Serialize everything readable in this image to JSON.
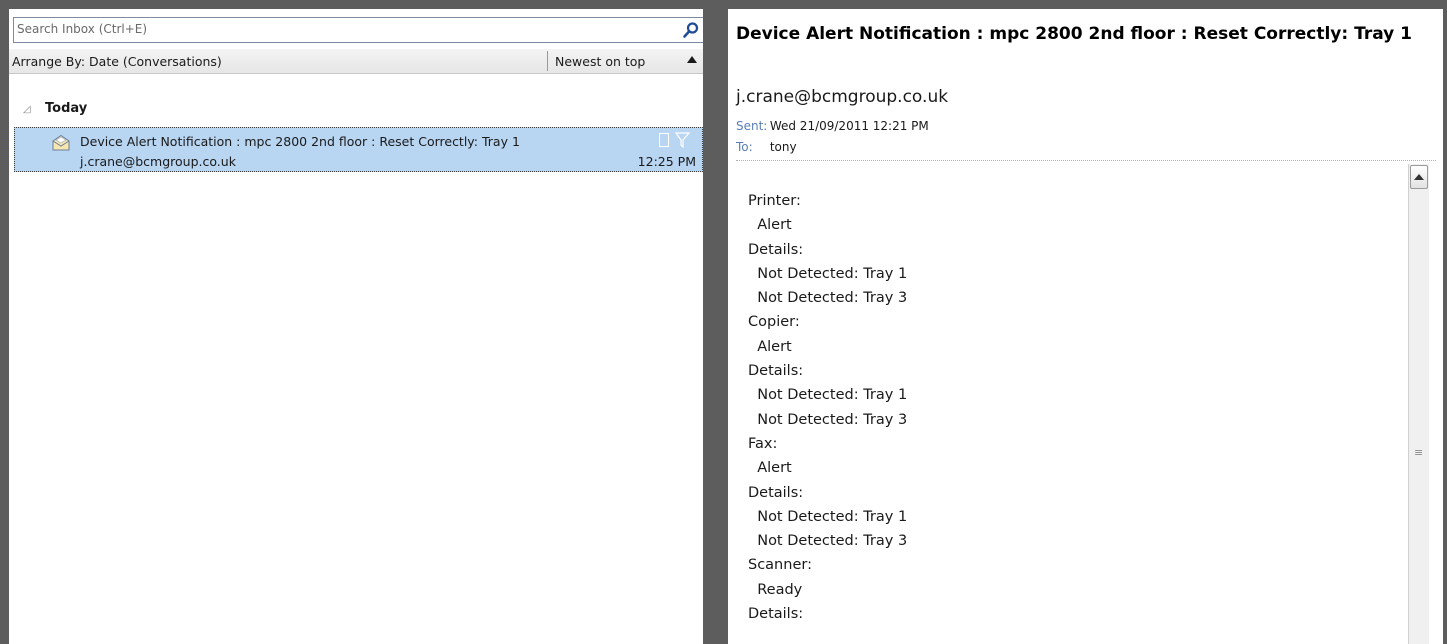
{
  "search": {
    "placeholder": "Search Inbox (Ctrl+E)"
  },
  "arrange": {
    "label": "Arrange By: Date (Conversations)",
    "sort_label": "Newest on top"
  },
  "groups": [
    {
      "title": "Today"
    }
  ],
  "messages": [
    {
      "subject": "Device Alert Notification : mpc 2800 2nd floor : Reset Correctly: Tray 1",
      "sender": "j.crane@bcmgroup.co.uk",
      "time": "12:25 PM"
    }
  ],
  "reading": {
    "subject": "Device Alert Notification : mpc 2800 2nd floor : Reset Correctly: Tray 1",
    "from": "j.crane@bcmgroup.co.uk",
    "sent_label": "Sent:",
    "sent_value": "Wed 21/09/2011 12:21 PM",
    "to_label": "To:",
    "to_value": "tony",
    "body": [
      "Printer:",
      "  Alert",
      "Details:",
      "  Not Detected: Tray 1",
      "  Not Detected: Tray 3",
      "Copier:",
      "  Alert",
      "Details:",
      "  Not Detected: Tray 1",
      "  Not Detected: Tray 3",
      "Fax:",
      "  Alert",
      "Details:",
      "  Not Detected: Tray 1",
      "  Not Detected: Tray 3",
      "Scanner:",
      "  Ready",
      "Details:"
    ]
  },
  "colors": {
    "selection": "#b8d5f2",
    "frame": "#5d5d5d",
    "meta_label": "#5a7fb8"
  },
  "icons": {
    "search": "search-icon",
    "collapse": "collapse-triangle-icon",
    "envelope": "open-envelope-icon",
    "category": "category-icon",
    "flag": "flag-icon"
  }
}
